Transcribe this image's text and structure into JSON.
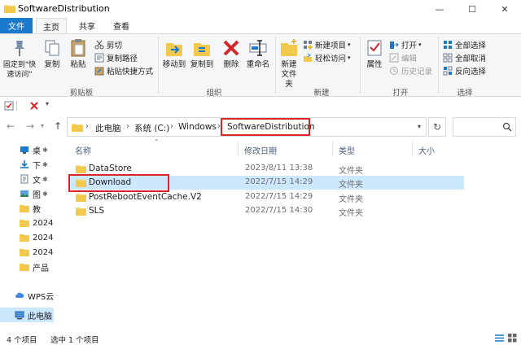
{
  "window": {
    "title": "SoftwareDistribution",
    "minimize": "—",
    "maximize": "☐",
    "close": "✕"
  },
  "ribbon_tabs": [
    "文件",
    "主页",
    "共享",
    "查看"
  ],
  "ribbon": {
    "clipboard": {
      "pin_quick_access": "固定到\"快速访问\"",
      "copy": "复制",
      "paste": "粘贴",
      "cut": "剪切",
      "copy_path": "复制路径",
      "paste_shortcut": "粘贴快捷方式",
      "group_label": "剪贴板"
    },
    "organize": {
      "move_to": "移动到",
      "copy_to": "复制到",
      "delete": "删除",
      "rename": "重命名",
      "group_label": "组织"
    },
    "new": {
      "new_folder": "新建文件夹",
      "new_item": "新建项目",
      "easy_access": "轻松访问",
      "group_label": "新建"
    },
    "open": {
      "properties": "属性",
      "open": "打开",
      "edit": "编辑",
      "history": "历史记录",
      "group_label": "打开"
    },
    "select": {
      "select_all": "全部选择",
      "select_none": "全部取消",
      "invert": "反向选择",
      "group_label": "选择"
    }
  },
  "address": {
    "crumbs": [
      "此电脑",
      "系统 (C:)",
      "Windows",
      "SoftwareDistribution"
    ],
    "separator": "›"
  },
  "nav_pane": [
    {
      "label": "桌",
      "icon": "desktop-icon"
    },
    {
      "label": "下",
      "icon": "download-icon"
    },
    {
      "label": "文",
      "icon": "document-icon"
    },
    {
      "label": "图",
      "icon": "picture-icon"
    },
    {
      "label": "教",
      "icon": "folder-icon"
    },
    {
      "label": "2024",
      "icon": "folder-icon"
    },
    {
      "label": "2024",
      "icon": "folder-icon"
    },
    {
      "label": "2024",
      "icon": "folder-icon"
    },
    {
      "label": "产品",
      "icon": "folder-icon"
    },
    {
      "label": "WPS云",
      "icon": "cloud-icon"
    },
    {
      "label": "此电脑",
      "icon": "computer-icon"
    }
  ],
  "columns": {
    "name": "名称",
    "date": "修改日期",
    "type": "类型",
    "size": "大小"
  },
  "files": [
    {
      "name": "DataStore",
      "date": "2023/8/11 13:38",
      "type": "文件夹"
    },
    {
      "name": "Download",
      "date": "2022/7/15 14:29",
      "type": "文件夹"
    },
    {
      "name": "PostRebootEventCache.V2",
      "date": "2022/7/15 14:29",
      "type": "文件夹"
    },
    {
      "name": "SLS",
      "date": "2022/7/15 14:30",
      "type": "文件夹"
    }
  ],
  "status": {
    "count": "4 个项目",
    "selected": "选中 1 个项目"
  },
  "colors": {
    "file_tab": "#1979ca",
    "selection": "#cce8ff",
    "highlight": "#d9262b",
    "folder": "#f8d775"
  }
}
